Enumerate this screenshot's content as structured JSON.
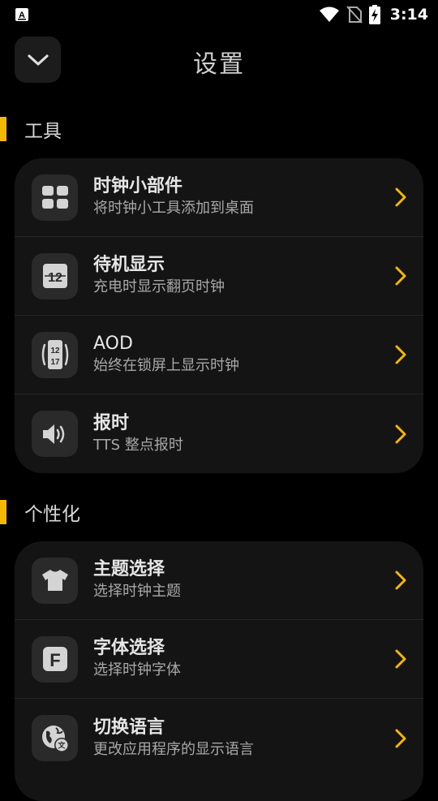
{
  "status": {
    "time": "3:14"
  },
  "header": {
    "title": "设置"
  },
  "sections": [
    {
      "title": "工具",
      "items": [
        {
          "title": "时钟小部件",
          "subtitle": "将时钟小工具添加到桌面",
          "icon": "widgets-icon"
        },
        {
          "title": "待机显示",
          "subtitle": "充电时显示翻页时钟",
          "icon": "flip-clock-icon"
        },
        {
          "title": "AOD",
          "subtitle": "始终在锁屏上显示时钟",
          "icon": "aod-phone-icon"
        },
        {
          "title": "报时",
          "subtitle": "TTS 整点报时",
          "icon": "speaker-icon"
        }
      ]
    },
    {
      "title": "个性化",
      "items": [
        {
          "title": "主题选择",
          "subtitle": "选择时钟主题",
          "icon": "tshirt-icon"
        },
        {
          "title": "字体选择",
          "subtitle": "选择时钟字体",
          "icon": "font-icon"
        },
        {
          "title": "切换语言",
          "subtitle": "更改应用程序的显示语言",
          "icon": "globe-translate-icon"
        }
      ]
    }
  ],
  "icon_glyphs": {
    "flip_clock_top": "12",
    "aod_top": "12",
    "aod_bottom": "17",
    "font_letter": "F"
  },
  "colors": {
    "accent": "#f5b800",
    "background": "#000000",
    "card": "#141414",
    "icon_tile": "#2a2a2a"
  }
}
